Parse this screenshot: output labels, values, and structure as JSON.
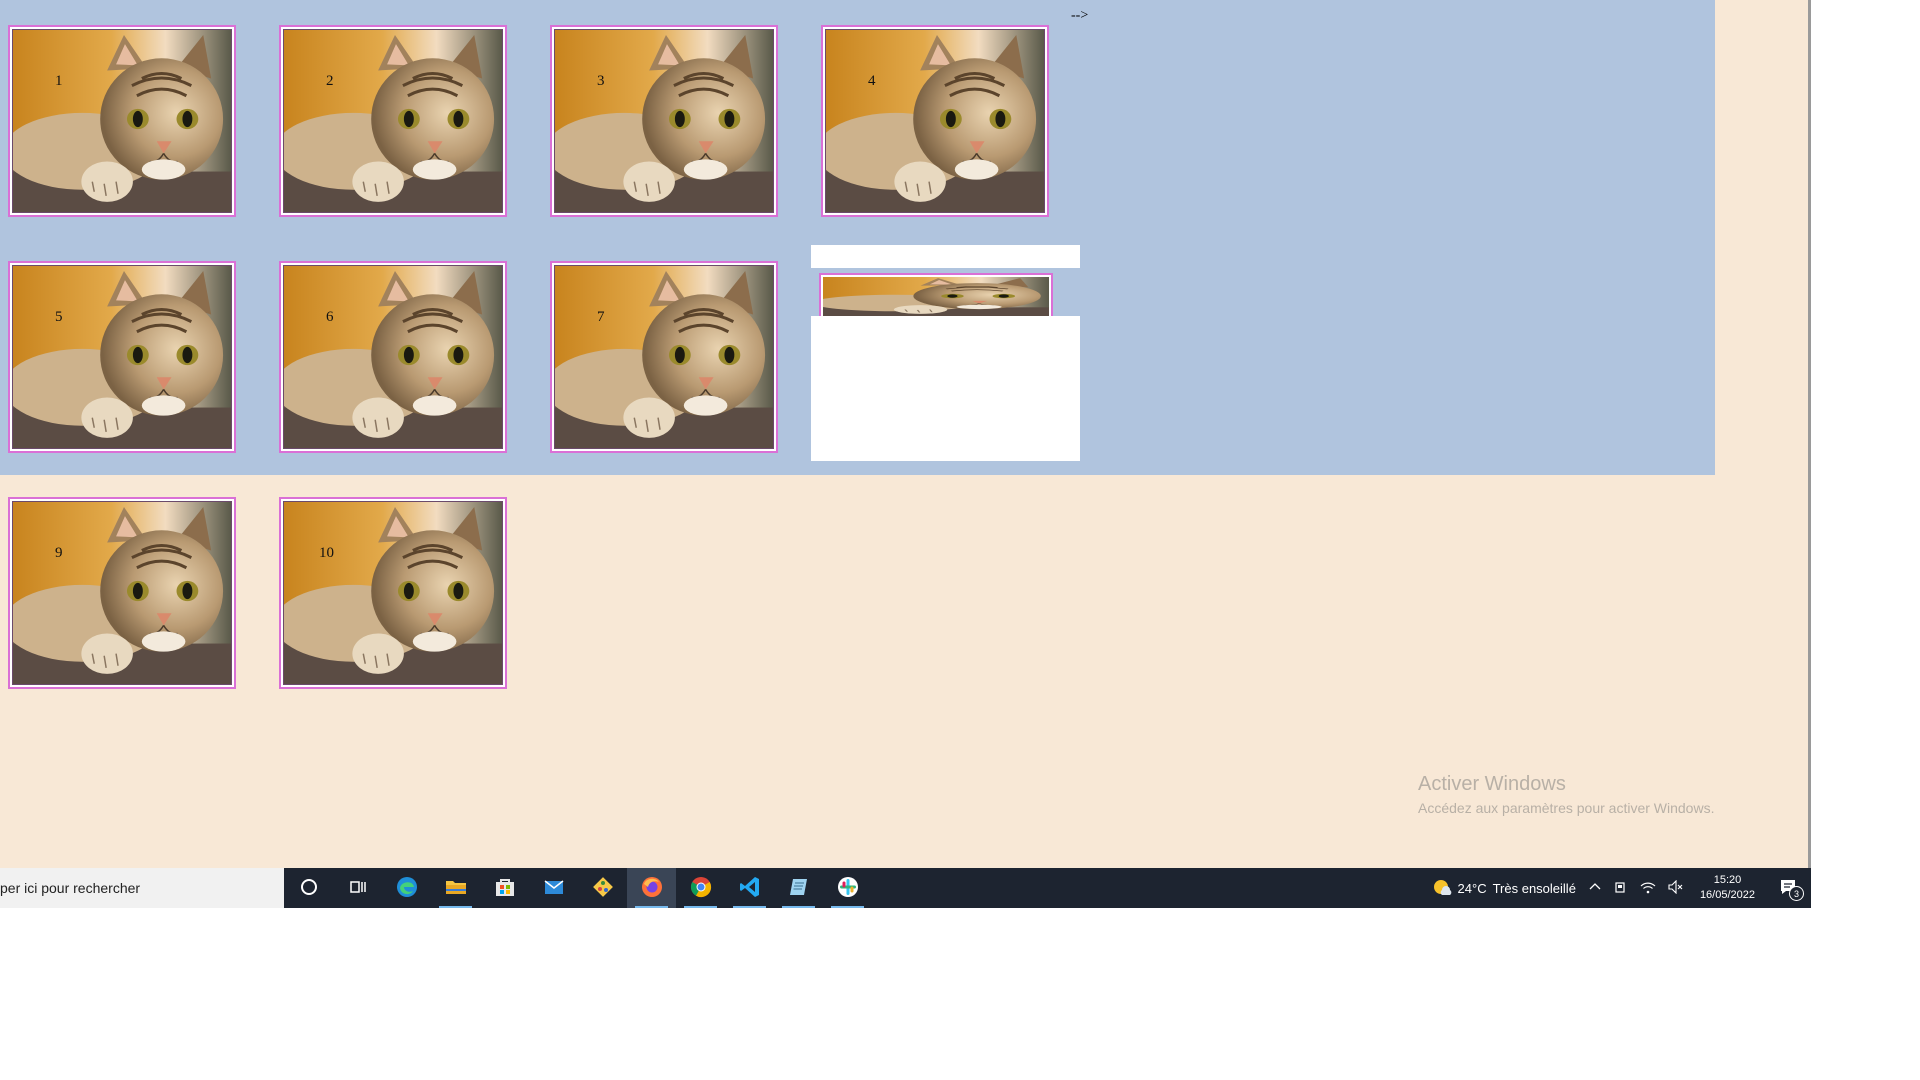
{
  "page": {
    "arrow_text": "-->",
    "tiles": [
      {
        "number": "1"
      },
      {
        "number": "2"
      },
      {
        "number": "3"
      },
      {
        "number": "4"
      },
      {
        "number": "5"
      },
      {
        "number": "6"
      },
      {
        "number": "7"
      },
      {
        "number": "9"
      },
      {
        "number": "10"
      }
    ]
  },
  "watermark": {
    "title": "Activer Windows",
    "subtitle": "Accédez aux paramètres pour activer Windows."
  },
  "taskbar": {
    "search_placeholder": "per ici pour rechercher",
    "apps": [
      {
        "icon": "cortana-icon"
      },
      {
        "icon": "task-view-icon"
      },
      {
        "icon": "edge-icon"
      },
      {
        "icon": "file-explorer-icon"
      },
      {
        "icon": "store-icon"
      },
      {
        "icon": "mail-icon"
      },
      {
        "icon": "git-icon"
      },
      {
        "icon": "firefox-icon"
      },
      {
        "icon": "chrome-icon"
      },
      {
        "icon": "vscode-icon"
      },
      {
        "icon": "notes-icon"
      },
      {
        "icon": "slack-icon"
      }
    ],
    "weather": {
      "temp": "24°C",
      "text": "Très ensoleillé"
    },
    "clock": {
      "time": "15:20",
      "date": "16/05/2022"
    },
    "notification_count": "3"
  },
  "colors": {
    "page_background": "#f8e8d6",
    "blue_area": "#b0c4de",
    "tile_border": "#da70d6",
    "taskbar": "#1d2430"
  }
}
